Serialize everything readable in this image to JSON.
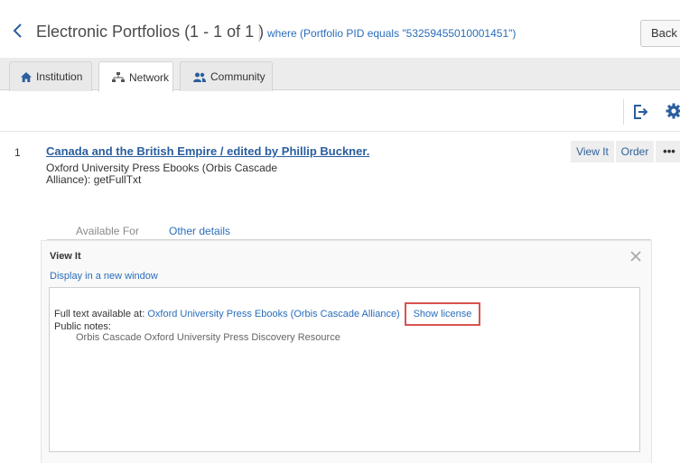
{
  "header": {
    "title": "Electronic Portfolios (1 - 1 of 1 )",
    "filter": "where (Portfolio PID equals \"53259455010001451\")",
    "back_label": "Back"
  },
  "tabs": [
    {
      "label": "Institution",
      "icon": "home-icon"
    },
    {
      "label": "Network",
      "icon": "network-icon",
      "active": true
    },
    {
      "label": "Community",
      "icon": "community-icon"
    }
  ],
  "record": {
    "number": "1",
    "title": "Canada and the British Empire / edited by Phillip Buckner.",
    "provider": "Oxford University Press Ebooks (Orbis Cascade Alliance): getFullTxt",
    "actions": {
      "view_it": "View It",
      "order": "Order",
      "more": "•••"
    }
  },
  "subtabs": [
    {
      "label": "Available For"
    },
    {
      "label": "Other details"
    }
  ],
  "panel": {
    "heading": "View It",
    "new_window_link": "Display in a new window",
    "fulltext_prefix": "Full text available at: ",
    "fulltext_link": "Oxford University Press Ebooks (Orbis Cascade Alliance)",
    "show_license": "Show license",
    "public_notes_label": "Public notes:",
    "public_notes_value": "Orbis Cascade Oxford University Press Discovery Resource"
  },
  "colors": {
    "link": "#2a6ebb",
    "title_link": "#2a5e9e",
    "tab_bar": "#ececec",
    "highlight_border": "#d9534f"
  }
}
